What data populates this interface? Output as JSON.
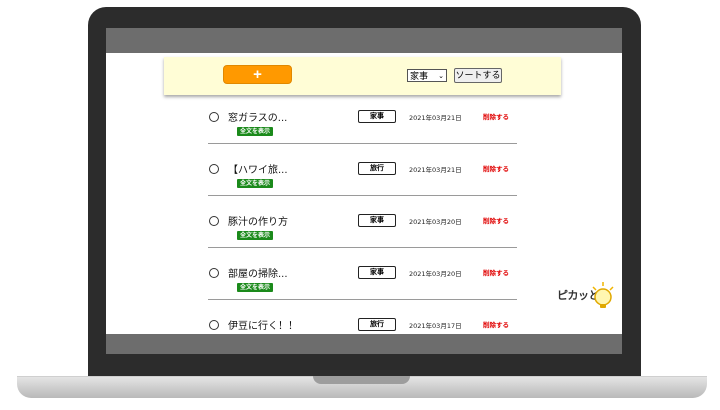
{
  "toolbar": {
    "add_label": "+",
    "category_selected": "家事",
    "sort_label": "ソートする"
  },
  "tasks": [
    {
      "title": "窓ガラスの...",
      "show_full": "全文を表示",
      "category": "家事",
      "date": "2021年03月21日",
      "delete": "削除する"
    },
    {
      "title": "【ハワイ旅...",
      "show_full": "全文を表示",
      "category": "旅行",
      "date": "2021年03月21日",
      "delete": "削除する"
    },
    {
      "title": "豚汁の作り方",
      "show_full": "全文を表示",
      "category": "家事",
      "date": "2021年03月20日",
      "delete": "削除する"
    },
    {
      "title": "部屋の掃除...",
      "show_full": "全文を表示",
      "category": "家事",
      "date": "2021年03月20日",
      "delete": "削除する"
    },
    {
      "title": "伊豆に行く！！",
      "show_full": "",
      "category": "旅行",
      "date": "2021年03月17日",
      "delete": "削除する"
    }
  ],
  "logo": {
    "text": "ピカッと",
    "icon": "lightbulb-icon"
  },
  "colors": {
    "accent": "#ff9900",
    "toolbar_bg": "#fffdd6",
    "badge": "#1b8a1b",
    "delete": "#e00000"
  }
}
